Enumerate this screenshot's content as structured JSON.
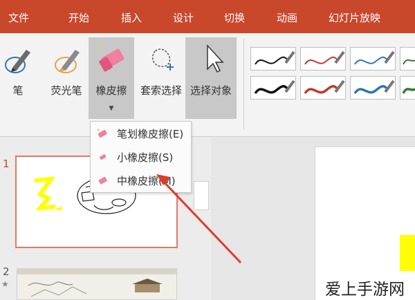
{
  "tabs": [
    "文件",
    "开始",
    "插入",
    "设计",
    "切换",
    "动画",
    "幻灯片放映"
  ],
  "tools": {
    "pen": "笔",
    "highlighter": "荧光笔",
    "eraser": "橡皮擦",
    "lasso": "套索选择",
    "select": "选择对象"
  },
  "eraser_menu": {
    "items": [
      "笔划橡皮擦(E)",
      "小橡皮擦(S)",
      "中橡皮擦(M)"
    ]
  },
  "pen_gallery": {
    "row1_colors": [
      "#111111",
      "#c0392b",
      "#2e75b6",
      "#2e7d32"
    ],
    "row2_colors": [
      "#111111",
      "#c0392b",
      "#2e75b6",
      "#2e7d32"
    ]
  },
  "slides": {
    "numbers": [
      "1",
      "2"
    ]
  },
  "watermark": "爱上手游网",
  "colors": {
    "ribbon_accent": "#c9472b",
    "highlight_yellow": "#ffff00",
    "arrow_red": "#e03a2a"
  }
}
